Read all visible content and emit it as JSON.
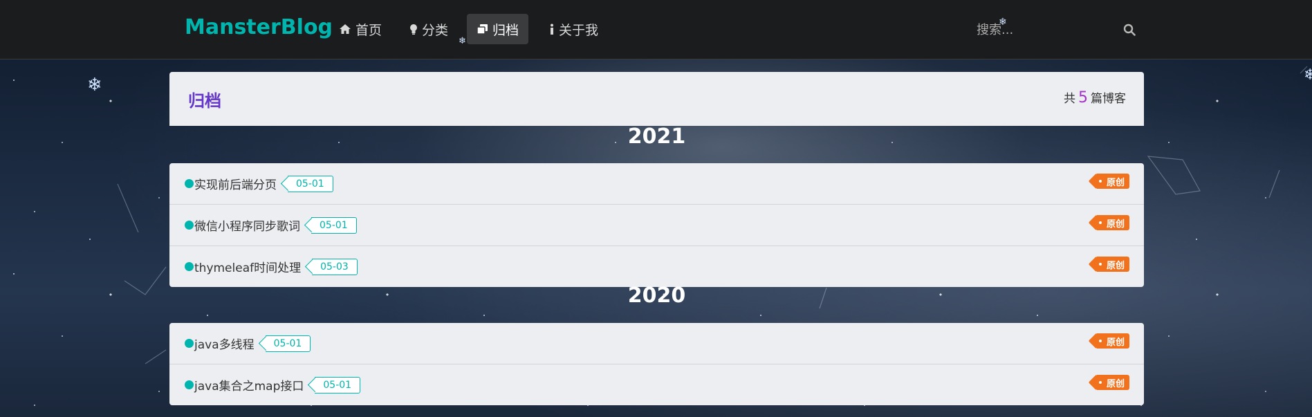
{
  "nav": {
    "brand": "MansterBlog",
    "items": [
      {
        "label": "首页",
        "icon": "home-icon"
      },
      {
        "label": "分类",
        "icon": "lightbulb-icon"
      },
      {
        "label": "归档",
        "icon": "clone-icon",
        "active": true
      },
      {
        "label": "关于我",
        "icon": "info-icon"
      }
    ],
    "search_placeholder": "搜索..."
  },
  "archive": {
    "title": "归档",
    "count_prefix": "共",
    "count": "5",
    "count_suffix": "篇博客"
  },
  "years": [
    {
      "year": "2021",
      "posts": [
        {
          "title": "实现前后端分页",
          "date": "05-01",
          "tag": "原创"
        },
        {
          "title": "微信小程序同步歌词",
          "date": "05-01",
          "tag": "原创"
        },
        {
          "title": "thymeleaf时间处理",
          "date": "05-03",
          "tag": "原创"
        }
      ]
    },
    {
      "year": "2020",
      "posts": [
        {
          "title": "java多线程",
          "date": "05-01",
          "tag": "原创"
        },
        {
          "title": "java集合之map接口",
          "date": "05-01",
          "tag": "原创"
        }
      ]
    }
  ],
  "colors": {
    "brand": "#00b5ad",
    "title": "#6435c9",
    "count": "#a333c8",
    "tag": "#f2711c"
  }
}
